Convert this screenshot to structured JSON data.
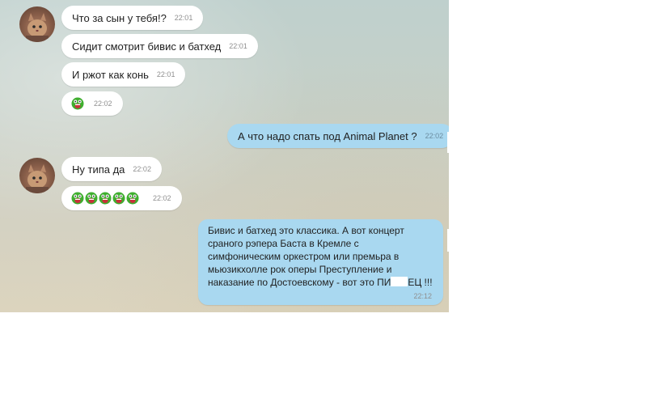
{
  "messages": [
    {
      "text": "Что за сын у тебя!?",
      "time": "22:01"
    },
    {
      "text": "Сидит смотрит бивис и батхед",
      "time": "22:01"
    },
    {
      "text": "И ржот как конь",
      "time": "22:01"
    },
    {
      "emoji": "laughing-face-icon",
      "count": 1,
      "time": "22:02"
    },
    {
      "text": "А что надо спать под Animal Planet ?",
      "time": "22:02"
    },
    {
      "text": "Ну типа да",
      "time": "22:02"
    },
    {
      "emoji": "laughing-face-icon",
      "count": 5,
      "time": "22:02"
    },
    {
      "lines": [
        "Бивис и батхед это классика. А вот концерт",
        "сраного рэпера Баста в Кремле с",
        "симфоническим оркестром или премьра в",
        "мьюзикхолле рок оперы Преступление и",
        "наказание по Достоевскому - вот это ПИ"
      ],
      "line5_end": "ЕЦ !!!",
      "time": "22:12"
    }
  ],
  "colors": {
    "incoming_bubble": "#ffffff",
    "outgoing_bubble": "#a9d8f0",
    "emoji_green": "#3fae2f",
    "emoji_red": "#c8323a"
  }
}
